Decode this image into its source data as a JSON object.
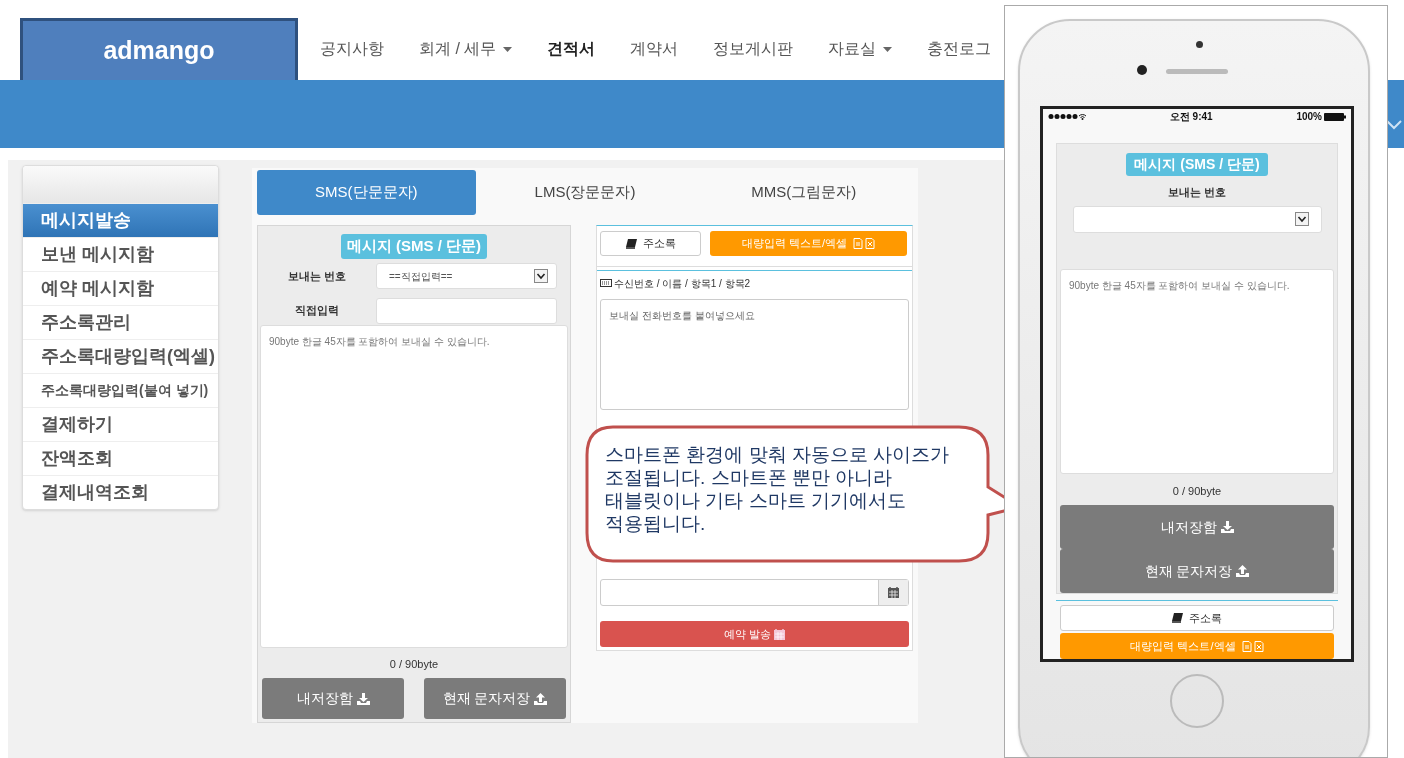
{
  "header": {
    "logo": "admango",
    "nav": [
      {
        "label": "공지사항",
        "dropdown": false,
        "selected": false
      },
      {
        "label": "회계 / 세무",
        "dropdown": true,
        "selected": false
      },
      {
        "label": "견적서",
        "dropdown": false,
        "selected": true
      },
      {
        "label": "계약서",
        "dropdown": false,
        "selected": false
      },
      {
        "label": "정보게시판",
        "dropdown": false,
        "selected": false
      },
      {
        "label": "자료실",
        "dropdown": true,
        "selected": false
      },
      {
        "label": "충전로그",
        "dropdown": false,
        "selected": false
      }
    ]
  },
  "sidebar": {
    "items": [
      {
        "label": "메시지발송",
        "selected": true,
        "kind": "normal"
      },
      {
        "label": "보낸 메시지함",
        "selected": false,
        "kind": "normal"
      },
      {
        "label": "예약 메시지함",
        "selected": false,
        "kind": "normal"
      },
      {
        "label": "주소록관리",
        "selected": false,
        "kind": "normal"
      },
      {
        "label": "주소록대량입력(엑셀)",
        "selected": false,
        "kind": "normal"
      },
      {
        "label": "주소록대량입력(붙여 넣기)",
        "selected": false,
        "kind": "compact"
      },
      {
        "label": "결제하기",
        "selected": false,
        "kind": "normal"
      },
      {
        "label": "잔액조회",
        "selected": false,
        "kind": "normal"
      },
      {
        "label": "결제내역조회",
        "selected": false,
        "kind": "normal"
      }
    ]
  },
  "tabs": [
    {
      "label": "SMS(단문문자)",
      "selected": true
    },
    {
      "label": "LMS(장문문자)",
      "selected": false
    },
    {
      "label": "MMS(그림문자)",
      "selected": false
    }
  ],
  "sms_form": {
    "badge": "메시지 (SMS / 단문)",
    "sender_label": "보내는 번호",
    "sender_value": "==직접입력==",
    "direct_label": "직접입력",
    "message_placeholder": "90byte 한글 45자를 포함하여 보내실 수 있습니다.",
    "counter": "0 / 90byte",
    "buttons": [
      "내저장함",
      "현재 문자저장"
    ]
  },
  "recipients": {
    "address_book_button": "주소록",
    "bulk_button": "대량입력 텍스트/엑셀",
    "list_label": "수신번호 / 이름 / 항목1 / 항목2",
    "numbers_placeholder": "보내실 전화번호를 붙여넣으세요",
    "schedule_button": "예약 발송"
  },
  "callout": {
    "lines": [
      "스마트폰 환경에 맞춰 자동으로 사이즈가",
      "조절됩니다. 스마트폰 뿐만 아니라",
      "태블릿이나 기타 스마트 기기에서도",
      "적용됩니다."
    ]
  },
  "phone": {
    "time": "오전 9:41",
    "battery": "100%",
    "badge": "메시지 (SMS / 단문)",
    "sender_label": "보내는 번호",
    "message_placeholder": "90byte 한글 45자를 포함하여 보내실 수 있습니다.",
    "counter": "0 / 90byte",
    "buttons": [
      "내저장함",
      "현재 문자저장"
    ],
    "address_book_button": "주소록",
    "bulk_button": "대량입력 텍스트/엑셀"
  }
}
